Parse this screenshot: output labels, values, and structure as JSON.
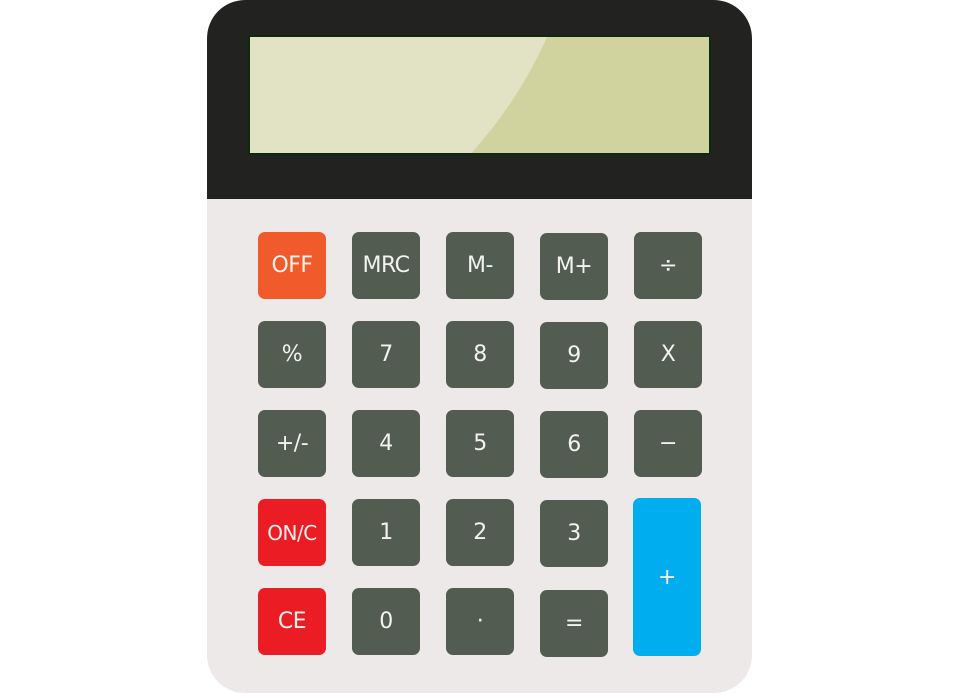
{
  "display": {
    "value": ""
  },
  "colors": {
    "body": "#ede9e8",
    "top_bezel": "#222220",
    "screen": "#d0d39e",
    "screen_glare": "#e2e3c4",
    "key_default": "#535c51",
    "key_off": "#f15a2b",
    "key_red": "#ec1c24",
    "key_plus": "#00adee",
    "key_text": "#f2f2ee"
  },
  "keys": {
    "off": "OFF",
    "mrc": "MRC",
    "m_minus": "M-",
    "m_plus": "M+",
    "divide": "÷",
    "percent": "%",
    "seven": "7",
    "eight": "8",
    "nine": "9",
    "multiply": "X",
    "plus_minus": "+/-",
    "four": "4",
    "five": "5",
    "six": "6",
    "minus": "−",
    "on_c": "ON/C",
    "one": "1",
    "two": "2",
    "three": "3",
    "plus": "+",
    "ce": "CE",
    "zero": "0",
    "decimal": "·",
    "equals": "="
  }
}
